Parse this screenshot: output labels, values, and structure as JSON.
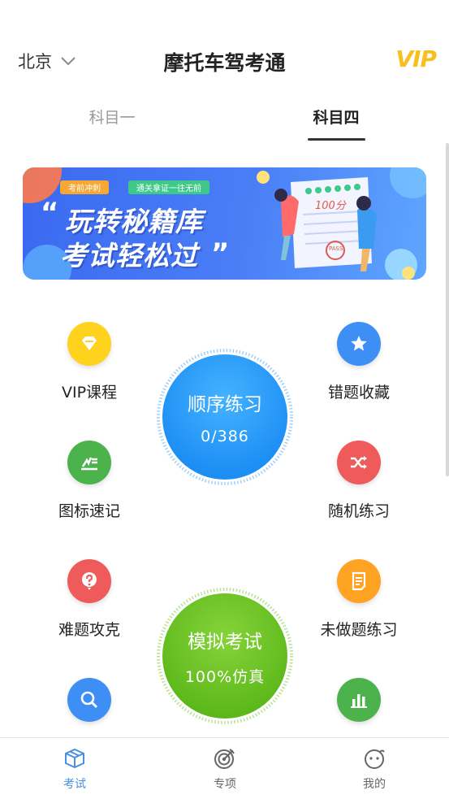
{
  "header": {
    "city": "北京",
    "title": "摩托车驾考通",
    "vip": "VIP"
  },
  "tabs": [
    {
      "label": "科目一",
      "active": false
    },
    {
      "label": "科目四",
      "active": true
    }
  ],
  "banner": {
    "tag1": "考前冲刺",
    "tag2": "通关拿证一往无前",
    "line1": "玩转秘籍库",
    "line2": "考试轻松过",
    "score": "100分",
    "stamp": "PASS"
  },
  "grid": {
    "vip_course": "VIP课程",
    "wrong_collect": "错题收藏",
    "icon_memo": "图标速记",
    "random_practice": "随机练习",
    "hard_questions": "难题攻克",
    "undone_practice": "未做题练习"
  },
  "sequential": {
    "label": "顺序练习",
    "progress": "0/386"
  },
  "mock_exam": {
    "label": "模拟考试",
    "subtitle": "100%仿真"
  },
  "bottom_nav": [
    {
      "label": "考试",
      "active": true
    },
    {
      "label": "专项",
      "active": false
    },
    {
      "label": "我的",
      "active": false
    }
  ],
  "colors": {
    "vip": "#f7c01c",
    "blue": "#1e90f5",
    "green": "#5fba1c",
    "active_nav": "#4a90e2"
  }
}
